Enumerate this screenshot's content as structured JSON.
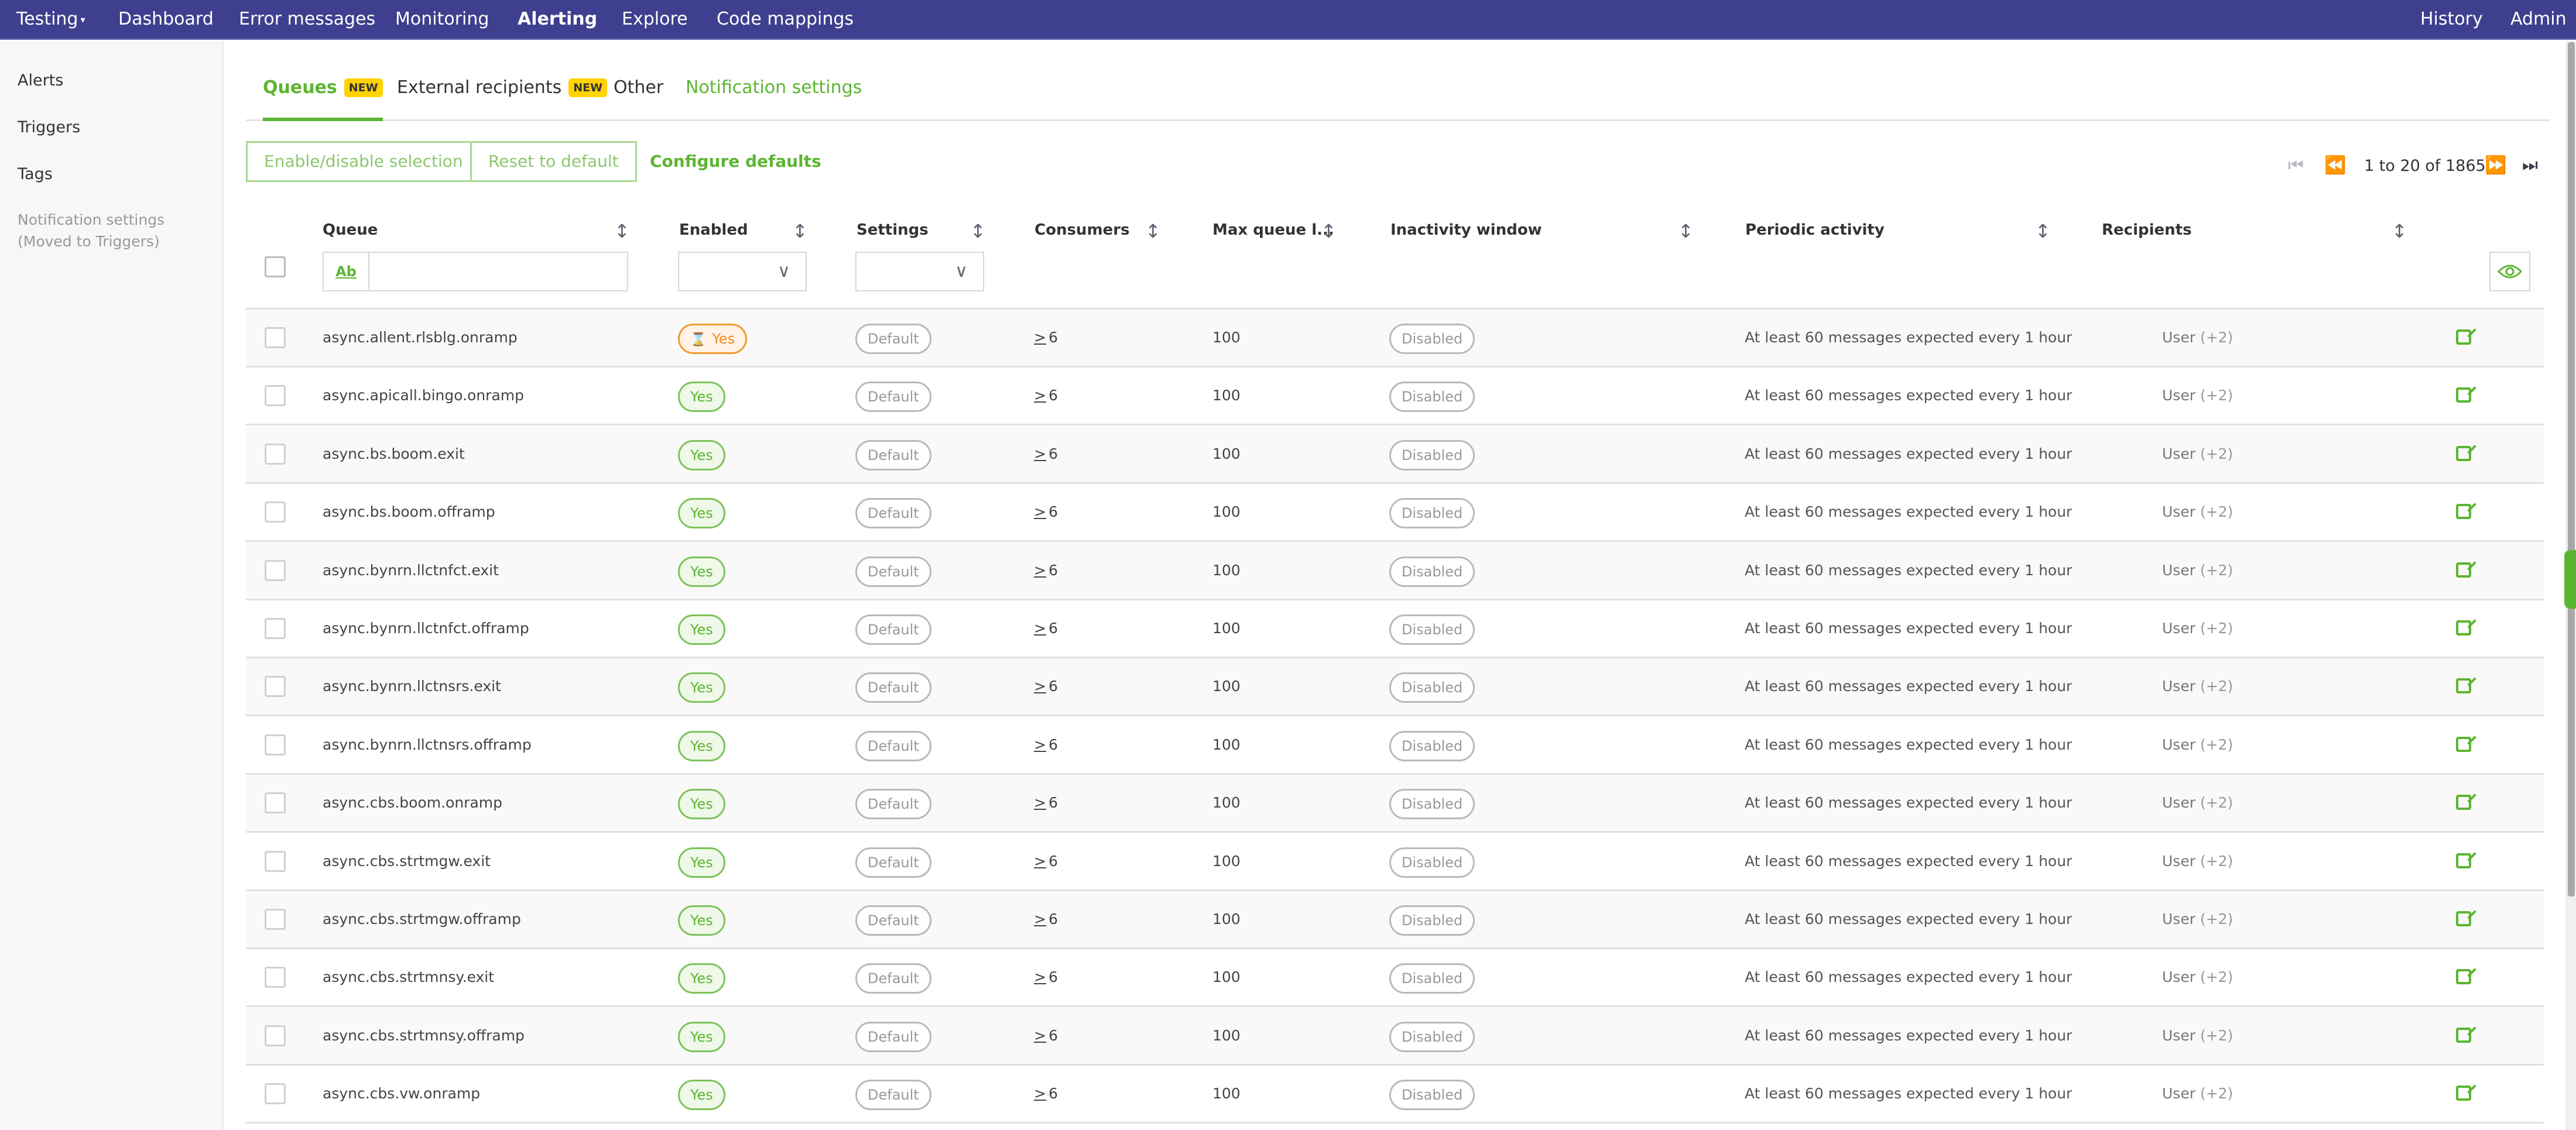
{
  "navbar": {
    "project": "Testing",
    "items": [
      "Dashboard",
      "Error messages",
      "Monitoring",
      "Alerting",
      "Explore",
      "Code mappings"
    ],
    "active": "Alerting",
    "right_items": [
      "History",
      "Admin"
    ]
  },
  "sidebar": {
    "items": [
      {
        "label": "Alerts"
      },
      {
        "label": "Triggers"
      },
      {
        "label": "Tags"
      },
      {
        "label": "Notification settings",
        "sublabel": "(Moved to Triggers)"
      }
    ]
  },
  "tabs": [
    {
      "label": "Queues",
      "badge": "NEW",
      "active": true
    },
    {
      "label": "External recipients",
      "badge": "NEW"
    },
    {
      "label": "Other"
    },
    {
      "label": "Notification settings"
    }
  ],
  "toolbar": {
    "enable_disable": "Enable/disable selection",
    "reset_default": "Reset to default",
    "configure_defaults": "Configure defaults"
  },
  "pagination": {
    "text": "1 to 20 of 1865",
    "first_icon": "first-page-icon",
    "prev_icon": "previous-page-icon",
    "next_icon": "next-page-icon",
    "last_icon": "last-page-icon"
  },
  "table": {
    "columns": [
      "Queue",
      "Enabled",
      "Settings",
      "Consumers",
      "Max queue l...",
      "Inactivity window",
      "Periodic activity",
      "Recipients"
    ],
    "filter": {
      "queue_match_icon": "Ab",
      "queue_value": "",
      "enabled_value": "",
      "settings_value": ""
    },
    "rows": [
      {
        "queue": "async.allent.rlsblg.onramp",
        "enabled": "Yes",
        "enabled_state": "pending",
        "settings": "Default",
        "consumers": "6",
        "max_queue": "100",
        "inactivity": "Disabled",
        "periodic": "At least 60 messages expected every 1 hour",
        "recipients": "User",
        "recipients_extra": "(+2)"
      },
      {
        "queue": "async.apicall.bingo.onramp",
        "enabled": "Yes",
        "enabled_state": "yes",
        "settings": "Default",
        "consumers": "6",
        "max_queue": "100",
        "inactivity": "Disabled",
        "periodic": "At least 60 messages expected every 1 hour",
        "recipients": "User",
        "recipients_extra": "(+2)"
      },
      {
        "queue": "async.bs.boom.exit",
        "enabled": "Yes",
        "enabled_state": "yes",
        "settings": "Default",
        "consumers": "6",
        "max_queue": "100",
        "inactivity": "Disabled",
        "periodic": "At least 60 messages expected every 1 hour",
        "recipients": "User",
        "recipients_extra": "(+2)"
      },
      {
        "queue": "async.bs.boom.offramp",
        "enabled": "Yes",
        "enabled_state": "yes",
        "settings": "Default",
        "consumers": "6",
        "max_queue": "100",
        "inactivity": "Disabled",
        "periodic": "At least 60 messages expected every 1 hour",
        "recipients": "User",
        "recipients_extra": "(+2)"
      },
      {
        "queue": "async.bynrn.llctnfct.exit",
        "enabled": "Yes",
        "enabled_state": "yes",
        "settings": "Default",
        "consumers": "6",
        "max_queue": "100",
        "inactivity": "Disabled",
        "periodic": "At least 60 messages expected every 1 hour",
        "recipients": "User",
        "recipients_extra": "(+2)"
      },
      {
        "queue": "async.bynrn.llctnfct.offramp",
        "enabled": "Yes",
        "enabled_state": "yes",
        "settings": "Default",
        "consumers": "6",
        "max_queue": "100",
        "inactivity": "Disabled",
        "periodic": "At least 60 messages expected every 1 hour",
        "recipients": "User",
        "recipients_extra": "(+2)"
      },
      {
        "queue": "async.bynrn.llctnsrs.exit",
        "enabled": "Yes",
        "enabled_state": "yes",
        "settings": "Default",
        "consumers": "6",
        "max_queue": "100",
        "inactivity": "Disabled",
        "periodic": "At least 60 messages expected every 1 hour",
        "recipients": "User",
        "recipients_extra": "(+2)"
      },
      {
        "queue": "async.bynrn.llctnsrs.offramp",
        "enabled": "Yes",
        "enabled_state": "yes",
        "settings": "Default",
        "consumers": "6",
        "max_queue": "100",
        "inactivity": "Disabled",
        "periodic": "At least 60 messages expected every 1 hour",
        "recipients": "User",
        "recipients_extra": "(+2)"
      },
      {
        "queue": "async.cbs.boom.onramp",
        "enabled": "Yes",
        "enabled_state": "yes",
        "settings": "Default",
        "consumers": "6",
        "max_queue": "100",
        "inactivity": "Disabled",
        "periodic": "At least 60 messages expected every 1 hour",
        "recipients": "User",
        "recipients_extra": "(+2)"
      },
      {
        "queue": "async.cbs.strtmgw.exit",
        "enabled": "Yes",
        "enabled_state": "yes",
        "settings": "Default",
        "consumers": "6",
        "max_queue": "100",
        "inactivity": "Disabled",
        "periodic": "At least 60 messages expected every 1 hour",
        "recipients": "User",
        "recipients_extra": "(+2)"
      },
      {
        "queue": "async.cbs.strtmgw.offramp",
        "enabled": "Yes",
        "enabled_state": "yes",
        "settings": "Default",
        "consumers": "6",
        "max_queue": "100",
        "inactivity": "Disabled",
        "periodic": "At least 60 messages expected every 1 hour",
        "recipients": "User",
        "recipients_extra": "(+2)"
      },
      {
        "queue": "async.cbs.strtmnsy.exit",
        "enabled": "Yes",
        "enabled_state": "yes",
        "settings": "Default",
        "consumers": "6",
        "max_queue": "100",
        "inactivity": "Disabled",
        "periodic": "At least 60 messages expected every 1 hour",
        "recipients": "User",
        "recipients_extra": "(+2)"
      },
      {
        "queue": "async.cbs.strtmnsy.offramp",
        "enabled": "Yes",
        "enabled_state": "yes",
        "settings": "Default",
        "consumers": "6",
        "max_queue": "100",
        "inactivity": "Disabled",
        "periodic": "At least 60 messages expected every 1 hour",
        "recipients": "User",
        "recipients_extra": "(+2)"
      },
      {
        "queue": "async.cbs.vw.onramp",
        "enabled": "Yes",
        "enabled_state": "yes",
        "settings": "Default",
        "consumers": "6",
        "max_queue": "100",
        "inactivity": "Disabled",
        "periodic": "At least 60 messages expected every 1 hour",
        "recipients": "User",
        "recipients_extra": "(+2)"
      }
    ]
  },
  "colors": {
    "navbar": "#3f3f8f",
    "accent_green": "#5cb531",
    "pending_orange": "#f08a1c",
    "badge_yellow": "#ffd200"
  }
}
